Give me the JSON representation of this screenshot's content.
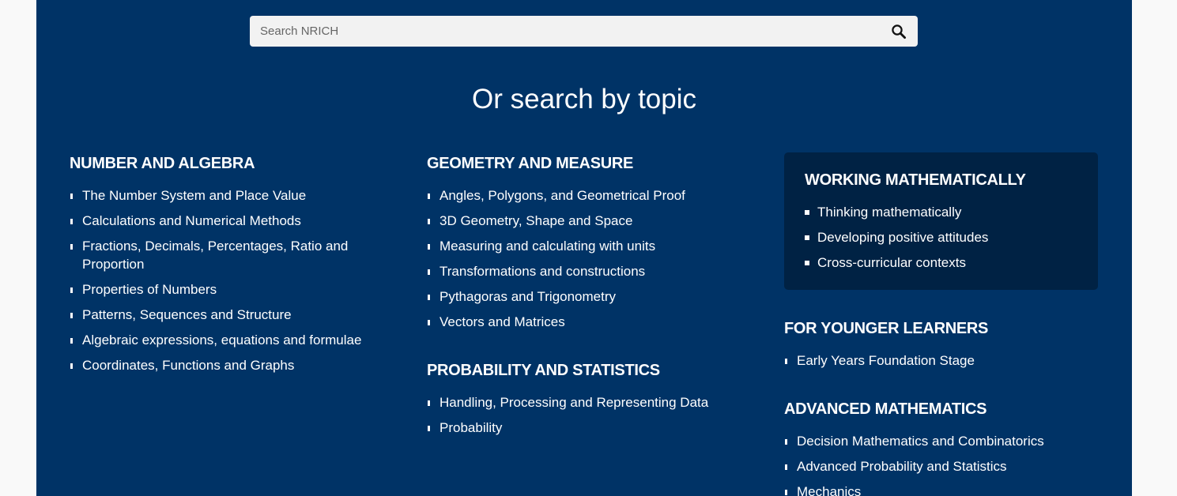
{
  "search": {
    "placeholder": "Search NRICH",
    "icon": "search-icon"
  },
  "heading": "Or search by topic",
  "columns": {
    "number_algebra": {
      "title": "NUMBER AND ALGEBRA",
      "items": [
        "The Number System and Place Value",
        "Calculations and Numerical Methods",
        "Fractions, Decimals, Percentages, Ratio and Proportion",
        "Properties of Numbers",
        "Patterns, Sequences and Structure",
        "Algebraic expressions, equations and formulae",
        "Coordinates, Functions and Graphs"
      ]
    },
    "geometry": {
      "title": "GEOMETRY AND MEASURE",
      "items": [
        "Angles, Polygons, and Geometrical Proof",
        "3D Geometry, Shape and Space",
        "Measuring and calculating with units",
        "Transformations and constructions",
        "Pythagoras and Trigonometry",
        "Vectors and Matrices"
      ]
    },
    "probability": {
      "title": "PROBABILITY AND STATISTICS",
      "items": [
        "Handling, Processing and Representing Data",
        "Probability"
      ]
    },
    "working": {
      "title": "WORKING MATHEMATICALLY",
      "items": [
        "Thinking mathematically",
        "Developing positive attitudes",
        "Cross-curricular contexts"
      ]
    },
    "younger": {
      "title": "FOR YOUNGER LEARNERS",
      "items": [
        "Early Years Foundation Stage"
      ]
    },
    "advanced": {
      "title": "ADVANCED MATHEMATICS",
      "items": [
        "Decision Mathematics and Combinatorics",
        "Advanced Probability and Statistics",
        "Mechanics"
      ]
    }
  },
  "colors": {
    "panel_bg": "#003366",
    "highlight_box_bg": "#002244",
    "page_bg": "#f9f9f9",
    "search_bg": "#f2f2f2"
  }
}
